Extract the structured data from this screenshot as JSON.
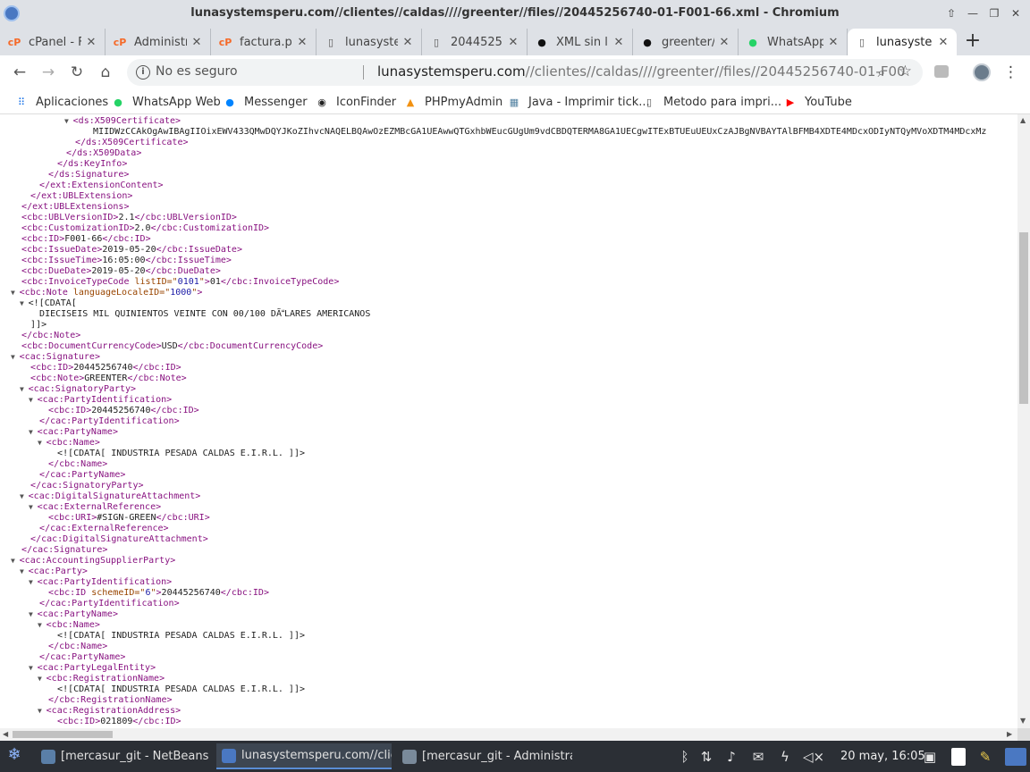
{
  "window": {
    "title": "lunasystemsperu.com//clientes//caldas////greenter//files//20445256740-01-F001-66.xml - Chromium"
  },
  "tabs": [
    {
      "label": "cPanel - F",
      "icon": "cpanel-icon",
      "active": false
    },
    {
      "label": "Administr",
      "icon": "cpanel-icon",
      "active": false
    },
    {
      "label": "factura.pl",
      "icon": "cpanel-icon",
      "active": false
    },
    {
      "label": "lunasyste",
      "icon": "page-icon",
      "active": false
    },
    {
      "label": "2044525(",
      "icon": "page-icon",
      "active": false
    },
    {
      "label": "XML sin li",
      "icon": "github-icon",
      "active": false
    },
    {
      "label": "greenter/",
      "icon": "github-icon",
      "active": false
    },
    {
      "label": "WhatsApp",
      "icon": "whatsapp-icon",
      "active": false
    },
    {
      "label": "lunasyste",
      "icon": "page-icon",
      "active": true
    }
  ],
  "toolbar": {
    "insecure_label": "No es seguro",
    "url_host": "lunasystemsperu.com",
    "url_path": "//clientes//caldas////greenter//files//20445256740-01-F001-66.xml"
  },
  "bookmarks": [
    {
      "label": "Aplicaciones",
      "icon": "apps-grid-icon"
    },
    {
      "label": "WhatsApp Web",
      "icon": "whatsapp-icon"
    },
    {
      "label": "Messenger",
      "icon": "messenger-icon"
    },
    {
      "label": "IconFinder",
      "icon": "iconfinder-icon"
    },
    {
      "label": "PHPmyAdmin",
      "icon": "phpmyadmin-icon"
    },
    {
      "label": "Java - Imprimir tick...",
      "icon": "java-icon"
    },
    {
      "label": "Metodo para impri...",
      "icon": "page-icon"
    },
    {
      "label": "YouTube",
      "icon": "youtube-icon"
    }
  ],
  "xml_lines": [
    {
      "indent": 8,
      "toggle": true,
      "kind": "open",
      "tag": "ds:X509Certificate"
    },
    {
      "indent": 10,
      "toggle": false,
      "kind": "text",
      "text": "MIIDWzCCAkOgAwIBAgIIOixEWV433QMwDQYJKoZIhvcNAQELBQAwOzEZMBcGA1UEAwwQTGxhbWEucGUgUm9vdCBDQTERMA8GA1UECgwITExBTUEuUEUxCzAJBgNVBAYTAlBFMB4XDTE4MDcxODIyNTQyMVoXDTM4MDcxMz"
    },
    {
      "indent": 8,
      "toggle": false,
      "kind": "close",
      "tag": "ds:X509Certificate"
    },
    {
      "indent": 7,
      "toggle": false,
      "kind": "close",
      "tag": "ds:X509Data"
    },
    {
      "indent": 6,
      "toggle": false,
      "kind": "close",
      "tag": "ds:KeyInfo"
    },
    {
      "indent": 5,
      "toggle": false,
      "kind": "close",
      "tag": "ds:Signature"
    },
    {
      "indent": 4,
      "toggle": false,
      "kind": "close",
      "tag": "ext:ExtensionContent"
    },
    {
      "indent": 3,
      "toggle": false,
      "kind": "close",
      "tag": "ext:UBLExtension"
    },
    {
      "indent": 2,
      "toggle": false,
      "kind": "close",
      "tag": "ext:UBLExtensions"
    },
    {
      "indent": 2,
      "toggle": false,
      "kind": "leaf",
      "tag": "cbc:UBLVersionID",
      "value": "2.1"
    },
    {
      "indent": 2,
      "toggle": false,
      "kind": "leaf",
      "tag": "cbc:CustomizationID",
      "value": "2.0"
    },
    {
      "indent": 2,
      "toggle": false,
      "kind": "leaf",
      "tag": "cbc:ID",
      "value": "F001-66"
    },
    {
      "indent": 2,
      "toggle": false,
      "kind": "leaf",
      "tag": "cbc:IssueDate",
      "value": "2019-05-20"
    },
    {
      "indent": 2,
      "toggle": false,
      "kind": "leaf",
      "tag": "cbc:IssueTime",
      "value": "16:05:00"
    },
    {
      "indent": 2,
      "toggle": false,
      "kind": "leaf",
      "tag": "cbc:DueDate",
      "value": "2019-05-20"
    },
    {
      "indent": 2,
      "toggle": false,
      "kind": "leafattr",
      "tag": "cbc:InvoiceTypeCode",
      "attr": "listID",
      "attrval": "0101",
      "value": "01"
    },
    {
      "indent": 2,
      "toggle": true,
      "kind": "openattr",
      "tag": "cbc:Note",
      "attr": "languageLocaleID",
      "attrval": "1000"
    },
    {
      "indent": 3,
      "toggle": true,
      "kind": "text",
      "text": "<![CDATA["
    },
    {
      "indent": 4,
      "toggle": false,
      "kind": "text",
      "text": "DIECISEIS MIL QUINIENTOS VEINTE CON 00/100 DÃLARES AMERICANOS"
    },
    {
      "indent": 3,
      "toggle": false,
      "kind": "text",
      "text": "]]>"
    },
    {
      "indent": 2,
      "toggle": false,
      "kind": "close",
      "tag": "cbc:Note"
    },
    {
      "indent": 2,
      "toggle": false,
      "kind": "leaf",
      "tag": "cbc:DocumentCurrencyCode",
      "value": "USD"
    },
    {
      "indent": 2,
      "toggle": true,
      "kind": "open",
      "tag": "cac:Signature"
    },
    {
      "indent": 3,
      "toggle": false,
      "kind": "leaf",
      "tag": "cbc:ID",
      "value": "20445256740"
    },
    {
      "indent": 3,
      "toggle": false,
      "kind": "leaf",
      "tag": "cbc:Note",
      "value": "GREENTER"
    },
    {
      "indent": 3,
      "toggle": true,
      "kind": "open",
      "tag": "cac:SignatoryParty"
    },
    {
      "indent": 4,
      "toggle": true,
      "kind": "open",
      "tag": "cac:PartyIdentification"
    },
    {
      "indent": 5,
      "toggle": false,
      "kind": "leaf",
      "tag": "cbc:ID",
      "value": "20445256740"
    },
    {
      "indent": 4,
      "toggle": false,
      "kind": "close",
      "tag": "cac:PartyIdentification"
    },
    {
      "indent": 4,
      "toggle": true,
      "kind": "open",
      "tag": "cac:PartyName"
    },
    {
      "indent": 5,
      "toggle": true,
      "kind": "open",
      "tag": "cbc:Name"
    },
    {
      "indent": 6,
      "toggle": false,
      "kind": "text",
      "text": "<![CDATA[ INDUSTRIA PESADA CALDAS E.I.R.L. ]]>"
    },
    {
      "indent": 5,
      "toggle": false,
      "kind": "close",
      "tag": "cbc:Name"
    },
    {
      "indent": 4,
      "toggle": false,
      "kind": "close",
      "tag": "cac:PartyName"
    },
    {
      "indent": 3,
      "toggle": false,
      "kind": "close",
      "tag": "cac:SignatoryParty"
    },
    {
      "indent": 3,
      "toggle": true,
      "kind": "open",
      "tag": "cac:DigitalSignatureAttachment"
    },
    {
      "indent": 4,
      "toggle": true,
      "kind": "open",
      "tag": "cac:ExternalReference"
    },
    {
      "indent": 5,
      "toggle": false,
      "kind": "leaf",
      "tag": "cbc:URI",
      "value": "#SIGN-GREEN"
    },
    {
      "indent": 4,
      "toggle": false,
      "kind": "close",
      "tag": "cac:ExternalReference"
    },
    {
      "indent": 3,
      "toggle": false,
      "kind": "close",
      "tag": "cac:DigitalSignatureAttachment"
    },
    {
      "indent": 2,
      "toggle": false,
      "kind": "close",
      "tag": "cac:Signature"
    },
    {
      "indent": 2,
      "toggle": true,
      "kind": "open",
      "tag": "cac:AccountingSupplierParty"
    },
    {
      "indent": 3,
      "toggle": true,
      "kind": "open",
      "tag": "cac:Party"
    },
    {
      "indent": 4,
      "toggle": true,
      "kind": "open",
      "tag": "cac:PartyIdentification"
    },
    {
      "indent": 5,
      "toggle": false,
      "kind": "leafattr",
      "tag": "cbc:ID",
      "attr": "schemeID",
      "attrval": "6",
      "value": "20445256740"
    },
    {
      "indent": 4,
      "toggle": false,
      "kind": "close",
      "tag": "cac:PartyIdentification"
    },
    {
      "indent": 4,
      "toggle": true,
      "kind": "open",
      "tag": "cac:PartyName"
    },
    {
      "indent": 5,
      "toggle": true,
      "kind": "open",
      "tag": "cbc:Name"
    },
    {
      "indent": 6,
      "toggle": false,
      "kind": "text",
      "text": "<![CDATA[ INDUSTRIA PESADA CALDAS E.I.R.L. ]]>"
    },
    {
      "indent": 5,
      "toggle": false,
      "kind": "close",
      "tag": "cbc:Name"
    },
    {
      "indent": 4,
      "toggle": false,
      "kind": "close",
      "tag": "cac:PartyName"
    },
    {
      "indent": 4,
      "toggle": true,
      "kind": "open",
      "tag": "cac:PartyLegalEntity"
    },
    {
      "indent": 5,
      "toggle": true,
      "kind": "open",
      "tag": "cbc:RegistrationName"
    },
    {
      "indent": 6,
      "toggle": false,
      "kind": "text",
      "text": "<![CDATA[ INDUSTRIA PESADA CALDAS E.I.R.L. ]]>"
    },
    {
      "indent": 5,
      "toggle": false,
      "kind": "close",
      "tag": "cbc:RegistrationName"
    },
    {
      "indent": 5,
      "toggle": true,
      "kind": "open",
      "tag": "cac:RegistrationAddress"
    },
    {
      "indent": 6,
      "toggle": false,
      "kind": "leaf",
      "tag": "cbc:ID",
      "value": "021809"
    }
  ],
  "taskbar": {
    "items": [
      {
        "label": "[mercasur_git - NetBeans ID...",
        "icon": "netbeans-icon",
        "active": false
      },
      {
        "label": "lunasystemsperu.com//client...",
        "icon": "chromium-icon",
        "active": true
      },
      {
        "label": "[mercasur_git - Administrad...",
        "icon": "folder-icon",
        "active": false
      }
    ],
    "clock": "20 may, 16:05"
  },
  "colors": {
    "tag": "#881280",
    "attr": "#994500",
    "attr_value": "#1a1aa6"
  }
}
